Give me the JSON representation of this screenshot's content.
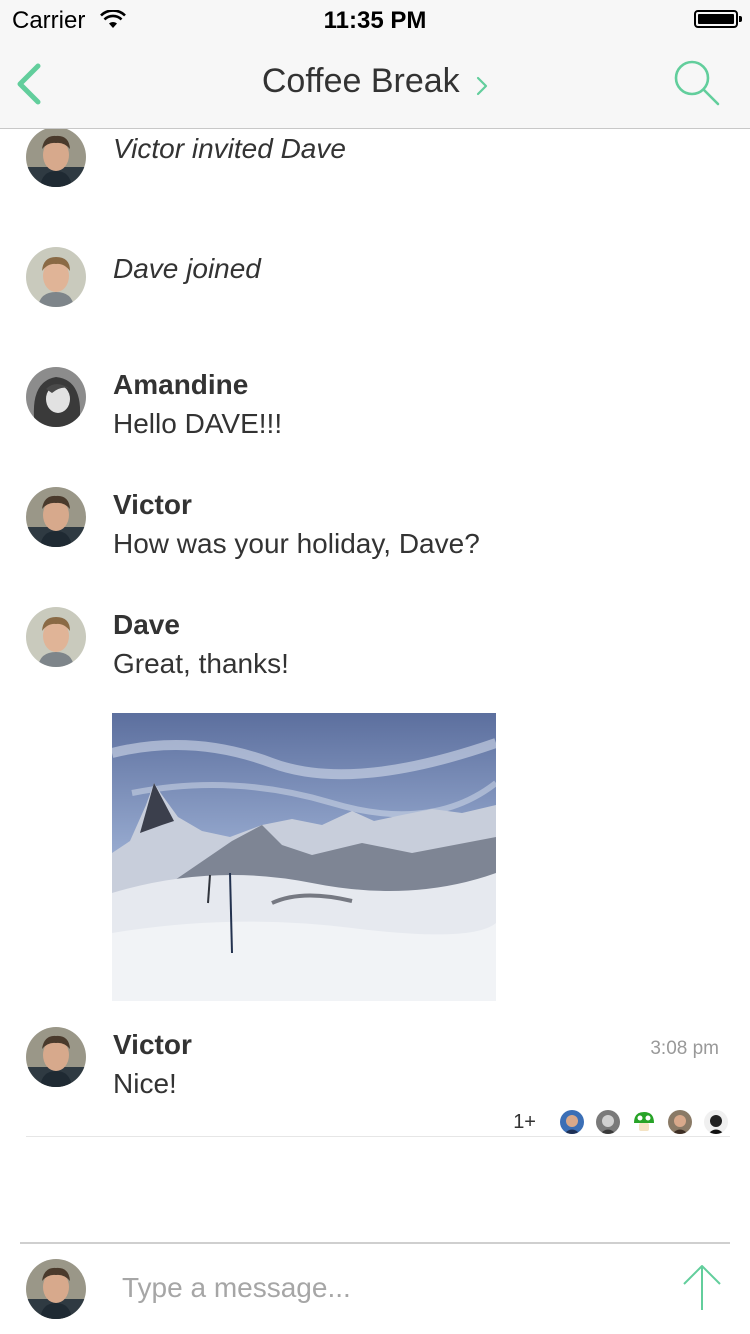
{
  "status_bar": {
    "carrier": "Carrier",
    "time": "11:35 PM"
  },
  "navbar": {
    "title": "Coffee Break",
    "accent_color": "#62ce9c"
  },
  "timeline": {
    "events": [
      {
        "type": "membership",
        "text": "Victor invited Dave",
        "avatar": "victor"
      },
      {
        "type": "membership",
        "text": "Dave joined",
        "avatar": "dave"
      }
    ],
    "messages": [
      {
        "sender": "Amandine",
        "body": "Hello DAVE!!!",
        "avatar": "amandine"
      },
      {
        "sender": "Victor",
        "body": "How was your holiday, Dave?",
        "avatar": "victor"
      },
      {
        "sender": "Dave",
        "body": "Great, thanks!",
        "avatar": "dave",
        "attachment": "mountain-photo"
      },
      {
        "sender": "Victor",
        "body": "Nice!",
        "avatar": "victor",
        "timestamp": "3:08 pm"
      }
    ],
    "read_receipts": {
      "more_count": "1+",
      "avatars": [
        "user-blue",
        "user-gray",
        "mushroom",
        "user-brown",
        "user-bw"
      ]
    }
  },
  "composer": {
    "placeholder": "Type a message...",
    "avatar": "victor"
  }
}
